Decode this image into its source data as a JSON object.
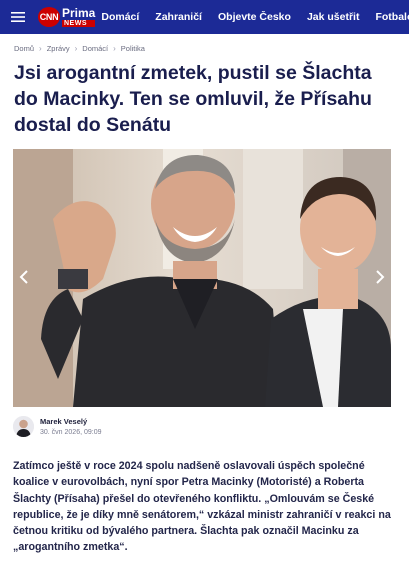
{
  "nav": {
    "logo_cnn": "CNN",
    "logo_prima": "Prima",
    "logo_news": "NEWS",
    "items": [
      "Domácí",
      "Zahraničí",
      "Objevte Česko",
      "Jak ušetřit",
      "Fotbalové MS"
    ]
  },
  "breadcrumb": [
    "Domů",
    "Zprávy",
    "Domácí",
    "Politika"
  ],
  "article": {
    "title": "Jsi arogantní zmetek, pustil se Šlachta do Macinky. Ten se omluvil, že Přísahu dostal do Senátu",
    "author": "Marek Veselý",
    "date": "30. čvn 2026, 09:09",
    "perex": "Zatímco ještě v roce 2024 spolu nadšeně oslavovali úspěch společné koalice v eurovolbách, nyní spor Petra Macinky (Motoristé) a Roberta Šlachty (Přísaha) přešel do otevřeného konfliktu. „Omlouvám se České republice, že je díky mně senátorem,“ vzkázal ministr zahraničí v reakci na četnou kritiku od bývalého partnera. Šlachta pak označil Macinku za „arogantního zmetka“."
  },
  "colors": {
    "nav_bg": "#1c2a96",
    "brand_red": "#cc0000",
    "title": "#1a1e4e"
  },
  "icons": [
    "menu-icon",
    "chevron-right-icon",
    "arrow-left-icon",
    "arrow-right-icon"
  ]
}
